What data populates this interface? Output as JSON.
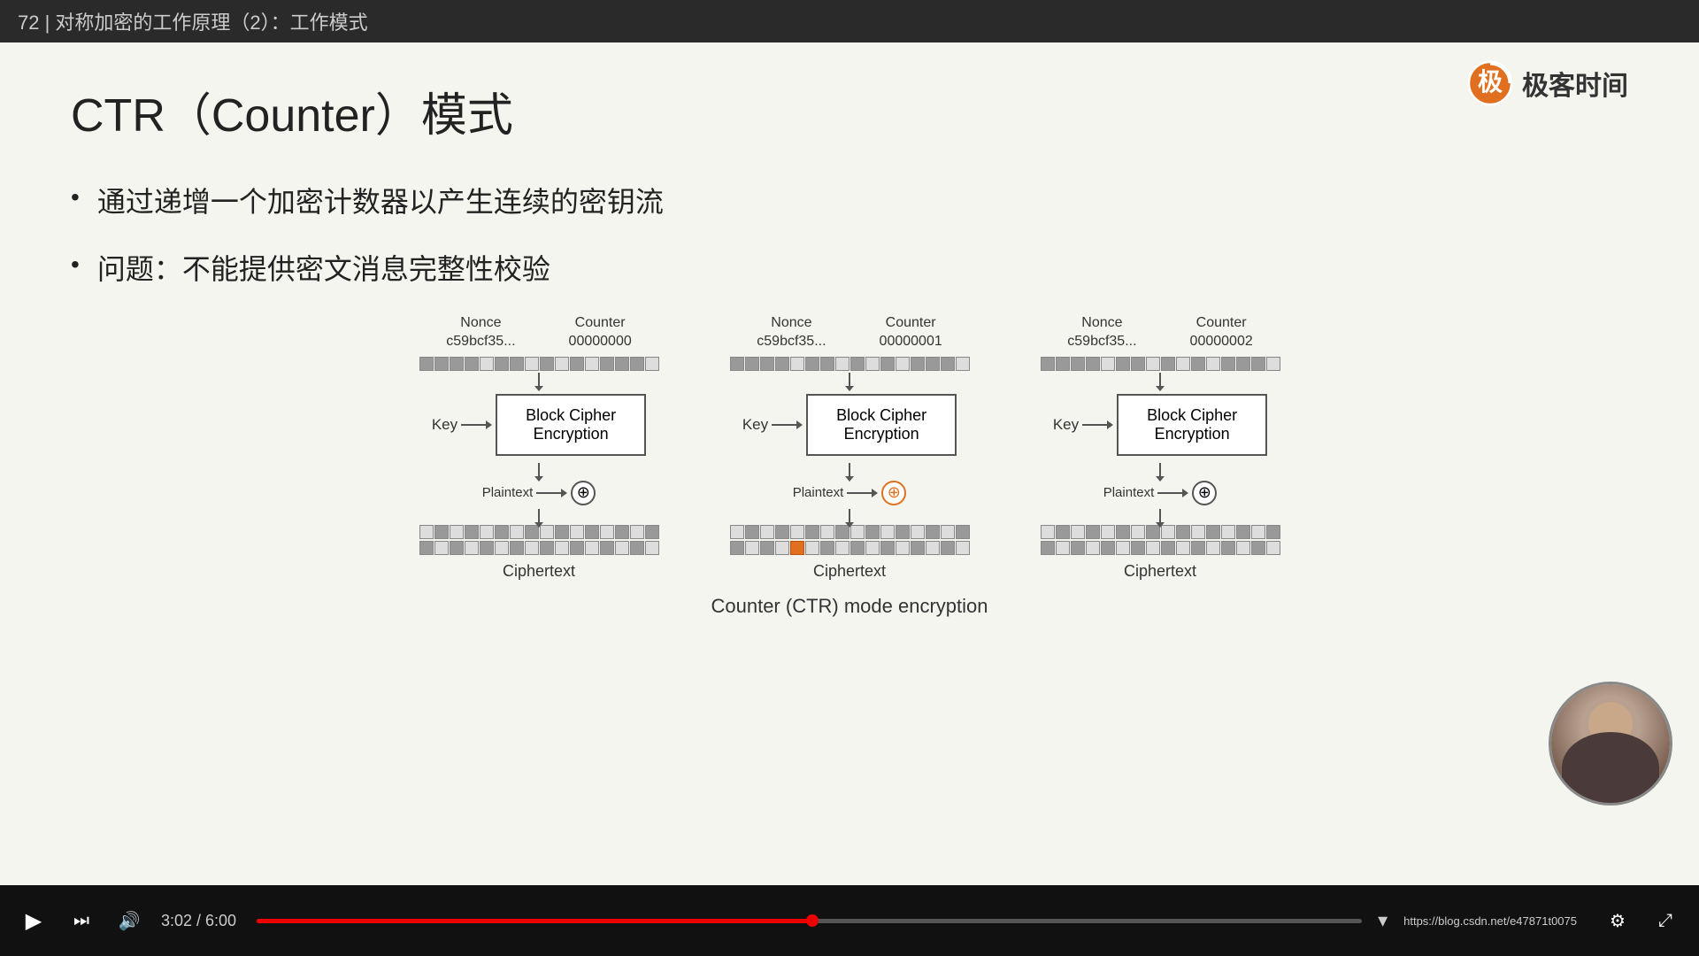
{
  "titleBar": {
    "text": "72 | 对称加密的工作原理（2）：工作模式"
  },
  "logo": {
    "text": "极客时间",
    "iconColor": "#e07020"
  },
  "slide": {
    "title": "CTR（Counter）模式",
    "bullets": [
      "通过递增一个加密计数器以产生连续的密钥流",
      "问题：不能提供密文消息完整性校验"
    ]
  },
  "diagram": {
    "caption": "Counter (CTR) mode encryption",
    "blocks": [
      {
        "nonce": "Nonce\nc59bcf35...",
        "counter": "Counter\n00000000",
        "boxLabel": "Block Cipher\nEncryption",
        "keyLabel": "Key",
        "plaintextLabel": "Plaintext",
        "ciphertextLabel": "Ciphertext",
        "activeXor": false
      },
      {
        "nonce": "Nonce\nc59bcf35...",
        "counter": "Counter\n00000001",
        "boxLabel": "Block Cipher\nEncryption",
        "keyLabel": "Key",
        "plaintextLabel": "Plaintext",
        "ciphertextLabel": "Ciphertext",
        "activeXor": true
      },
      {
        "nonce": "Nonce\nc59bcf35...",
        "counter": "Counter\n00000002",
        "boxLabel": "Block Cipher\nEncryption",
        "keyLabel": "Key",
        "plaintextLabel": "Plaintext",
        "ciphertextLabel": "Ciphertext",
        "activeXor": false
      }
    ]
  },
  "controls": {
    "time": "3:02 / 6:00",
    "progress": 50.3,
    "url": "https://blog.csdn.net/e47871t0075",
    "playIcon": "▶",
    "nextIcon": "⏭",
    "volumeIcon": "🔊"
  }
}
